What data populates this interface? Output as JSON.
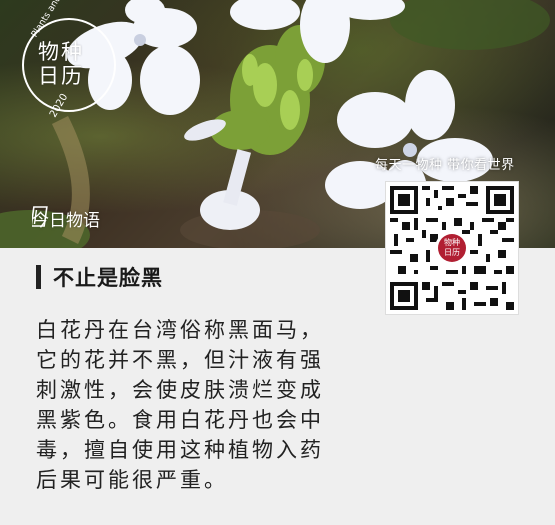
{
  "stamp": {
    "title_line1": "物种",
    "title_line2": "日历",
    "english": "Plants and Animals",
    "year": "2020"
  },
  "banner": {
    "slogan": "每天一物种 带你看世界",
    "today_label": "今日物语",
    "today_icon": "book-icon"
  },
  "qr": {
    "logo_line1": "物种",
    "logo_line2": "日历",
    "logo_color": "#b11f32"
  },
  "section": {
    "title": "不止是脸黑"
  },
  "body_lines": [
    "白花丹在台湾俗称黑面马，",
    "它的花并不黑，但汁液有强",
    "刺激性，会使皮肤溃烂变成",
    "黑紫色。食用白花丹也会中",
    "毒，擅自使用这种植物入药",
    "后果可能很严重。"
  ]
}
